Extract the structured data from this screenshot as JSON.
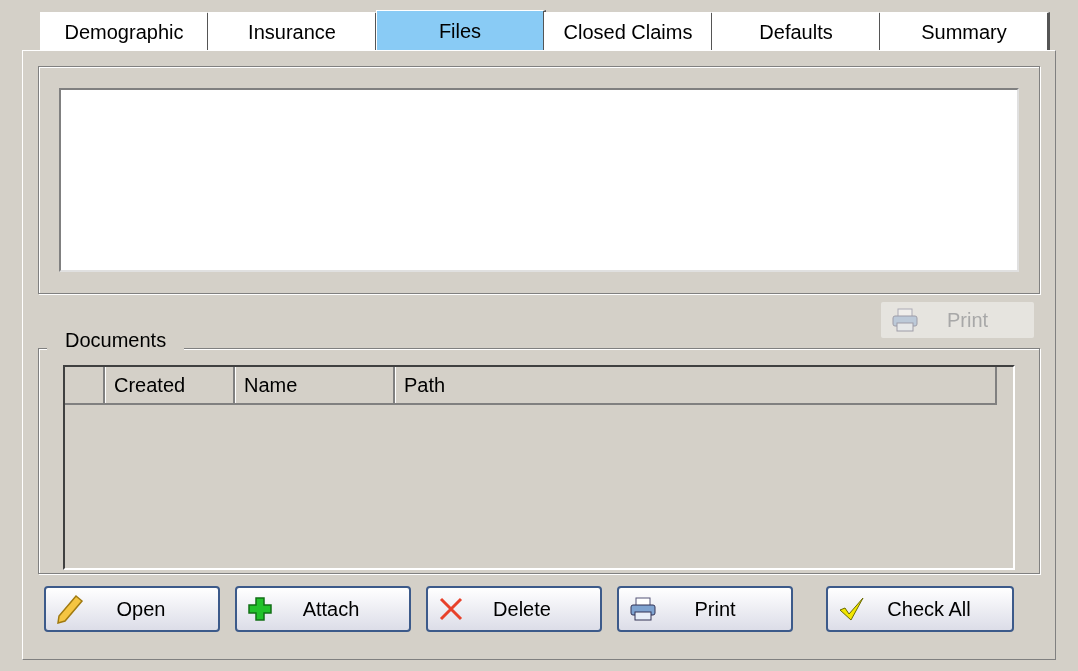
{
  "tabs": [
    {
      "label": "Demographic",
      "selected": false
    },
    {
      "label": "Insurance",
      "selected": false
    },
    {
      "label": "Files",
      "selected": true
    },
    {
      "label": "Closed Claims",
      "selected": false
    },
    {
      "label": "Defaults",
      "selected": false
    },
    {
      "label": "Summary",
      "selected": false
    }
  ],
  "print_button": {
    "label": "Print",
    "disabled": true
  },
  "documents": {
    "title": "Documents",
    "columns": [
      "Created",
      "Name",
      "Path"
    ]
  },
  "buttons": [
    {
      "label": "Open",
      "kind": "pencil"
    },
    {
      "label": "Attach",
      "kind": "plus"
    },
    {
      "label": "Delete",
      "kind": "cross"
    },
    {
      "label": "Print",
      "kind": "printer"
    },
    {
      "label": "Check All",
      "kind": "check"
    }
  ]
}
